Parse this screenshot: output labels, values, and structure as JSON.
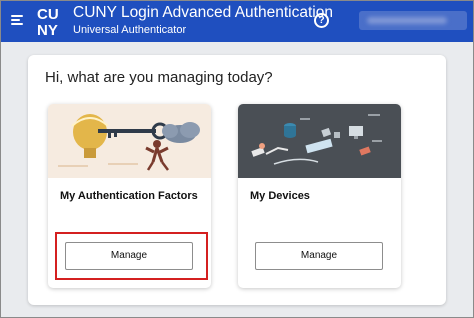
{
  "header": {
    "title": "CUNY Login Advanced Authentication",
    "subtitle": "Universal Authenticator",
    "logo_text": "CUNY",
    "icons": {
      "menu": "menu-icon",
      "help": "help-icon"
    },
    "help_glyph": "?",
    "bg_color": "#1f4fbf"
  },
  "main": {
    "greeting": "Hi, what are you managing today?",
    "tiles": [
      {
        "title": "My Authentication Factors",
        "button_label": "Manage",
        "image": "key-lightbulb-illustration"
      },
      {
        "title": "My Devices",
        "button_label": "Manage",
        "image": "devices-illustration"
      }
    ]
  },
  "colors": {
    "highlight": "#d42020",
    "tile_devices_bg": "#4a4f55",
    "tile_auth_bg": "#f6ebe0"
  }
}
